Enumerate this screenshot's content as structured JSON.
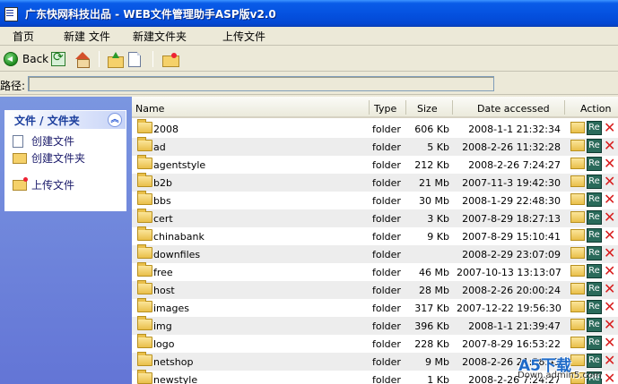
{
  "window": {
    "title": "广东快网科技出品 - WEB文件管理助手ASP版v2.0"
  },
  "menu": {
    "items": [
      "首页",
      "新建 文件",
      "新建文件夹",
      "上传文件"
    ]
  },
  "toolbar": {
    "back_label": "Back"
  },
  "path": {
    "label": "路径:",
    "value": ""
  },
  "sidebar": {
    "title": "文件 / 文件夹",
    "collapse_glyph": "︽",
    "items": [
      "创建文件",
      "创建文件夹",
      "上传文件"
    ]
  },
  "table": {
    "headers": {
      "name": "Name",
      "type": "Type",
      "size": "Size",
      "date": "Date accessed",
      "action": "Action"
    },
    "rename_label": "Re",
    "delete_glyph": "✕",
    "rows": [
      {
        "name": "2008",
        "type": "folder",
        "size": "606 Kb",
        "date": "2008-1-1 21:32:34"
      },
      {
        "name": "ad",
        "type": "folder",
        "size": "5 Kb",
        "date": "2008-2-26 11:32:28"
      },
      {
        "name": "agentstyle",
        "type": "folder",
        "size": "212 Kb",
        "date": "2008-2-26 7:24:27"
      },
      {
        "name": "b2b",
        "type": "folder",
        "size": "21 Mb",
        "date": "2007-11-3 19:42:30"
      },
      {
        "name": "bbs",
        "type": "folder",
        "size": "30 Mb",
        "date": "2008-1-29 22:48:30"
      },
      {
        "name": "cert",
        "type": "folder",
        "size": "3 Kb",
        "date": "2007-8-29 18:27:13"
      },
      {
        "name": "chinabank",
        "type": "folder",
        "size": "9 Kb",
        "date": "2007-8-29 15:10:41"
      },
      {
        "name": "downfiles",
        "type": "folder",
        "size": "",
        "date": "2008-2-29 23:07:09"
      },
      {
        "name": "free",
        "type": "folder",
        "size": "46 Mb",
        "date": "2007-10-13 13:13:07"
      },
      {
        "name": "host",
        "type": "folder",
        "size": "28 Mb",
        "date": "2008-2-26 20:00:24"
      },
      {
        "name": "images",
        "type": "folder",
        "size": "317 Kb",
        "date": "2007-12-22 19:56:30"
      },
      {
        "name": "img",
        "type": "folder",
        "size": "396 Kb",
        "date": "2008-1-1 21:39:47"
      },
      {
        "name": "logo",
        "type": "folder",
        "size": "228 Kb",
        "date": "2007-8-29 16:53:22"
      },
      {
        "name": "netshop",
        "type": "folder",
        "size": "9 Mb",
        "date": "2008-2-26 21:56:43"
      },
      {
        "name": "newstyle",
        "type": "folder",
        "size": "1 Kb",
        "date": "2008-2-26 7:24:27"
      }
    ]
  },
  "watermark": {
    "brand": "A5下载",
    "url": "Down.admin5.com"
  }
}
